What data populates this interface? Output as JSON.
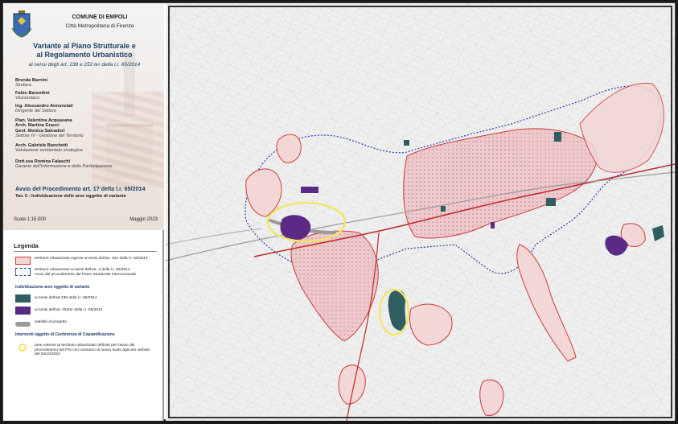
{
  "header": {
    "comune": "COMUNE DI EMPOLI",
    "metro": "Città Metropolitana di Firenze",
    "title_line1": "Variante al Piano Strutturale e",
    "title_line2": "al Regolamento Urbanistico",
    "subtitle": "ai sensi degli art. 238 e 252 ter della l.r. 65/2014",
    "people": [
      {
        "name": "Brenda Barnini",
        "role": "Sindaco"
      },
      {
        "name": "Fabio Barsottini",
        "role": "Vicesindaco"
      },
      {
        "name": "Ing. Alessandro Annunziati",
        "role": "Dirigente del Settore"
      },
      {
        "name": "Pian. Valentina Acquasana",
        "name2": "Arch. Martina Gracci",
        "name3": "Geol. Monica Salvadori",
        "role": "Settore IV - Gestione del Territorio"
      },
      {
        "name": "Arch. Gabriele Banchetti",
        "role": "Valutazione ambientale strategica"
      },
      {
        "name": "Dott.ssa Romina Falaschi",
        "role": "Garante dell'Informazione e della Partecipazione"
      }
    ],
    "avvio": "Avvio del Procedimento art. 17 della l.r. 65/2014",
    "tav": "Tav. 5 - Individuazione delle aree oggetto di variante",
    "scala": "Scala 1:15.000",
    "data": "Maggio 2023"
  },
  "legend": {
    "title": "Legenda",
    "items": [
      {
        "swatch": "pink",
        "text": "territorio urbanizzato vigente ai sensi dell'art. 224 della l.r. 65/2014"
      },
      {
        "swatch": "dotted",
        "text": "territorio urbanizzato ai sensi dell'art. 4 della l.r. 65/2014",
        "text2": "Avvio del procedimento del Piano Strutturale Intercomunale"
      }
    ],
    "section_aree": "Individuazione aree oggetto di variante",
    "aree": [
      {
        "swatch": "teal",
        "text": "ai sensi dell'art.238 della l.r. 65/2014"
      },
      {
        "swatch": "purple",
        "text": "ai sensi dell'art. 252ter della l.r. 65/2014"
      }
    ],
    "viabilita": "viabilità di progetto",
    "section_interventi": "Interventi oggetto di Conferenza di Copianificazione",
    "interventi": "aree esterne al territorio urbanizzato definito per l'avvio del procedimento del PSI con consumo di nuovo suolo agricolo verbale del 04/10/2023"
  },
  "colors": {
    "title_blue": "#1c3f66",
    "urban_pink": "#f3d6d6",
    "urban_border": "#d03a3a",
    "psi_dotted": "#2a3fa8",
    "teal": "#2f5e60",
    "purple": "#5b2a86",
    "ring_yellow": "#f1e56a"
  }
}
